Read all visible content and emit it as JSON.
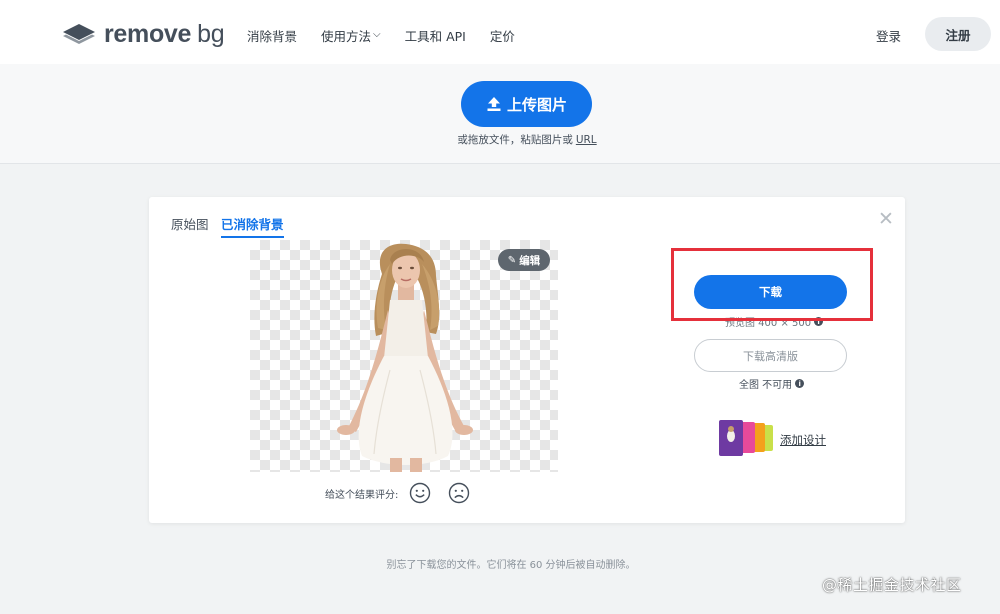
{
  "header": {
    "logo_word": "remove",
    "logo_suffix": "bg",
    "nav": [
      {
        "label": "消除背景"
      },
      {
        "label": "使用方法",
        "has_dropdown": true
      },
      {
        "label": "工具和 API"
      },
      {
        "label": "定价"
      }
    ],
    "login_label": "登录",
    "signup_label": "注册"
  },
  "upload": {
    "button_label": "上传图片",
    "hint_text": "或拖放文件，粘贴图片或",
    "hint_link": "URL"
  },
  "result": {
    "tabs": [
      {
        "label": "原始图",
        "active": false
      },
      {
        "label": "已消除背景",
        "active": true
      }
    ],
    "close_symbol": "✕",
    "edit_label": "编辑",
    "rate_label": "给这个结果评分:",
    "download_label": "下载",
    "preview_size_text": "预览图 400 × 500",
    "download_hd_label": "下载高清版",
    "hd_note": "全图 不可用",
    "add_design_label": "添加设计"
  },
  "footer_note": "别忘了下载您的文件。它们将在 60 分钟后被自动删除。",
  "watermark": "@稀土掘金技术社区",
  "colors": {
    "accent": "#1374e9",
    "highlight": "#e5303b",
    "page_bg": "#f1f3f4"
  },
  "icons": [
    "logo-layers-icon",
    "chevron-down-icon",
    "upload-arrow-icon",
    "close-icon",
    "pencil-icon",
    "smile-face-icon",
    "sad-face-icon",
    "info-icon"
  ]
}
